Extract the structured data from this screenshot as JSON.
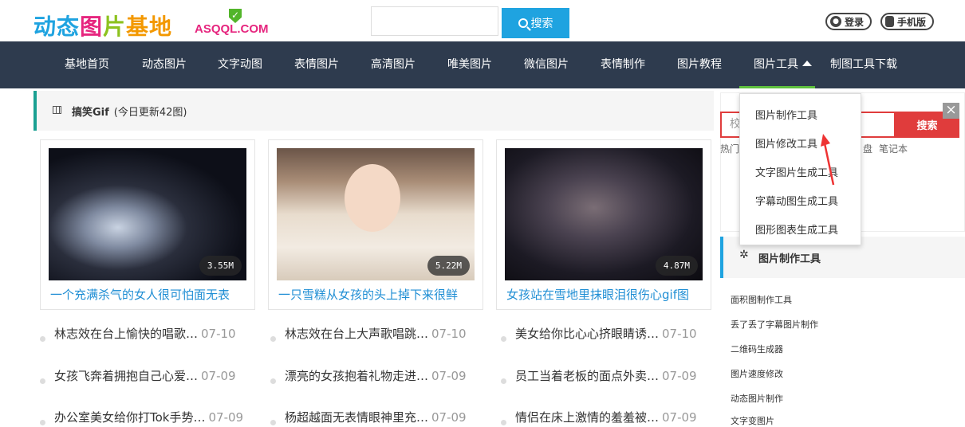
{
  "header": {
    "logo_text": "动态图片基地",
    "logo_sub": "ASQQL.COM",
    "search_placeholder": "",
    "search_button": "搜索",
    "login": "登录",
    "mobile": "手机版"
  },
  "nav": {
    "items": [
      "基地首页",
      "动态图片",
      "文字动图",
      "表情图片",
      "高清图片",
      "唯美图片",
      "微信图片",
      "表情制作",
      "图片教程",
      "图片工具",
      "制图工具下载"
    ]
  },
  "section": {
    "title": "搞笑Gif",
    "subtitle": "(今日更新42图)"
  },
  "cards": [
    {
      "size": "3.55M",
      "caption": "一个充满杀气的女人很可怕面无表"
    },
    {
      "size": "5.22M",
      "caption": "一只雪糕从女孩的头上掉下来很鲜"
    },
    {
      "size": "4.87M",
      "caption": "女孩站在雪地里抹眼泪很伤心gif图"
    }
  ],
  "lists": [
    [
      {
        "title": "林志效在台上愉快的唱歌…",
        "date": "07-10"
      },
      {
        "title": "女孩飞奔着拥抱自己心爱…",
        "date": "07-09"
      },
      {
        "title": "办公室美女给你打Tok手势…",
        "date": "07-09"
      }
    ],
    [
      {
        "title": "林志效在台上大声歌唱跳…",
        "date": "07-10"
      },
      {
        "title": "漂亮的女孩抱着礼物走进…",
        "date": "07-09"
      },
      {
        "title": "杨超越面无表情眼神里充…",
        "date": "07-09"
      }
    ],
    [
      {
        "title": "美女给你比心心挤眼睛诱…",
        "date": "07-10"
      },
      {
        "title": "员工当着老板的面点外卖…",
        "date": "07-09"
      },
      {
        "title": "情侣在床上激情的羞羞被…",
        "date": "07-09"
      }
    ]
  ],
  "sidebar": {
    "search_placeholder": "校",
    "search_button": "搜索",
    "close": "×",
    "hot_label": "热门",
    "hot_tags": [
      "盘",
      "笔记本"
    ],
    "tool_head": "图片制作工具",
    "tool_links": [
      "面积图制作工具",
      "丢了丢了字幕图片制作",
      "二维码生成器",
      "图片速度修改",
      "动态图片制作",
      "文字变图片"
    ]
  },
  "dropdown": {
    "items": [
      "图片制作工具",
      "图片修改工具",
      "文字图片生成工具",
      "字幕动图生成工具",
      "图形图表生成工具"
    ]
  },
  "colors": {
    "nav_bg": "#2e3b4e",
    "accent_blue": "#1fa3e0",
    "accent_red": "#e03c3c",
    "accent_green": "#5ec03e"
  }
}
